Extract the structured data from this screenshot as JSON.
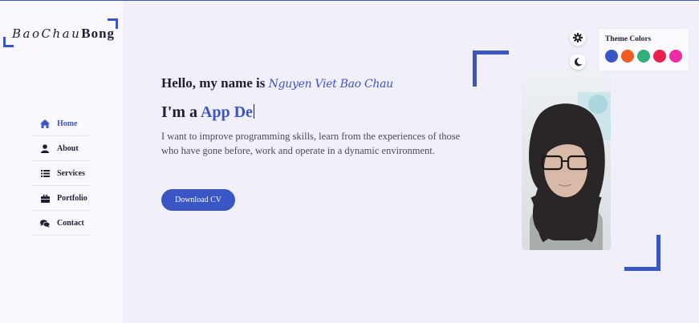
{
  "logo": {
    "part1": "BaoChau",
    "part2": "Bong"
  },
  "sidebar": {
    "items": [
      {
        "label": "Home",
        "icon": "home-icon",
        "active": true
      },
      {
        "label": "About",
        "icon": "user-icon",
        "active": false
      },
      {
        "label": "Services",
        "icon": "list-icon",
        "active": false
      },
      {
        "label": "Portfolio",
        "icon": "briefcase-icon",
        "active": false
      },
      {
        "label": "Contact",
        "icon": "comments-icon",
        "active": false
      }
    ]
  },
  "hero": {
    "greeting": "Hello, my name is ",
    "name": "Nguyen Viet Bao Chau",
    "role_prefix": "I'm a ",
    "role_typed": "App De",
    "description": "I want to improve programming skills, learn from the experiences of those who have gone before, work and operate in a dynamic environment.",
    "cv_button": "Download CV"
  },
  "theme": {
    "title": "Theme Colors",
    "swatches": [
      "#3a56c5",
      "#f25c1f",
      "#32b07a",
      "#ec1f4f",
      "#ee2aa7"
    ]
  },
  "colors": {
    "accent": "#3a56c5",
    "text": "#1d1f33",
    "background": "#f1f0fa",
    "sidebar": "#fbf8ff"
  }
}
